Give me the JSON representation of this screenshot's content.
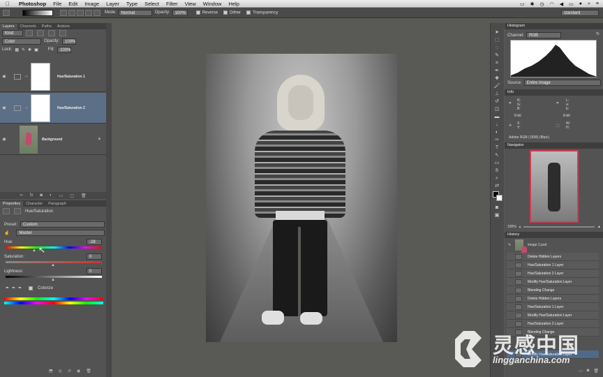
{
  "menubar": {
    "apple": "",
    "items": [
      "Photoshop",
      "File",
      "Edit",
      "Image",
      "Layer",
      "Type",
      "Select",
      "Filter",
      "View",
      "Window",
      "Help"
    ]
  },
  "options": {
    "mode_label": "Mode:",
    "mode_value": "Normal",
    "opacity_label": "Opacity:",
    "opacity_value": "100%",
    "reverse": "Reverse",
    "dither": "Dither",
    "transparency": "Transparency",
    "workspace": "standard"
  },
  "layers_panel": {
    "tabs": [
      "Layers",
      "Channels",
      "Paths",
      "Actions"
    ],
    "kind": "Kind",
    "blend_mode": "Color",
    "opacity_label": "Opacity:",
    "opacity_value": "100%",
    "lock_label": "Lock:",
    "fill_label": "Fill:",
    "fill_value": "100%",
    "layers": [
      {
        "name": "Hue/Saturation 1"
      },
      {
        "name": "Hue/Saturation 2"
      },
      {
        "name": "Background"
      }
    ]
  },
  "properties_panel": {
    "tabs": [
      "Properties",
      "Character",
      "Paragraph"
    ],
    "title": "Hue/Saturation",
    "preset_label": "Preset:",
    "preset_value": "Custom",
    "channel_value": "Master",
    "hue_label": "Hue:",
    "hue_value": "-28",
    "saturation_label": "Saturation:",
    "saturation_value": "0",
    "lightness_label": "Lightness:",
    "lightness_value": "0",
    "colorize_label": "Colorize"
  },
  "histogram_panel": {
    "title": "Histogram",
    "channel_label": "Channel:",
    "channel_value": "RGB",
    "source_label": "Source:",
    "source_value": "Entire Image"
  },
  "info_panel": {
    "title": "Info",
    "r": "R:",
    "g": "G:",
    "b": "B:",
    "l": "L:",
    "a": "a:",
    "bb": "b:",
    "bit1": "8-bit",
    "bit2": "8-bit",
    "x": "X:",
    "y": "Y:",
    "w": "W:",
    "h": "H:",
    "profile": "Adobe RGB (1998) (8bpc)"
  },
  "navigator_panel": {
    "title": "Navigator",
    "zoom": "100%"
  },
  "history_panel": {
    "title": "History",
    "snapshot": "image 2.psd",
    "items": [
      "Delete Hidden Layers",
      "Hue/Saturation 1 Layer",
      "Hue/Saturation 2 Layer",
      "Modify Hue/Saturation Layer",
      "Blending Change",
      "Delete Hidden Layers",
      "Hue/Saturation 1 Layer",
      "Modify Hue/Saturation Layer",
      "Hue/Saturation 2 Layer",
      "Blending Change",
      "Modify Hue/Saturation Layer"
    ]
  },
  "watermark": {
    "cn": "灵感中国",
    "en": "lingganchina.com"
  }
}
